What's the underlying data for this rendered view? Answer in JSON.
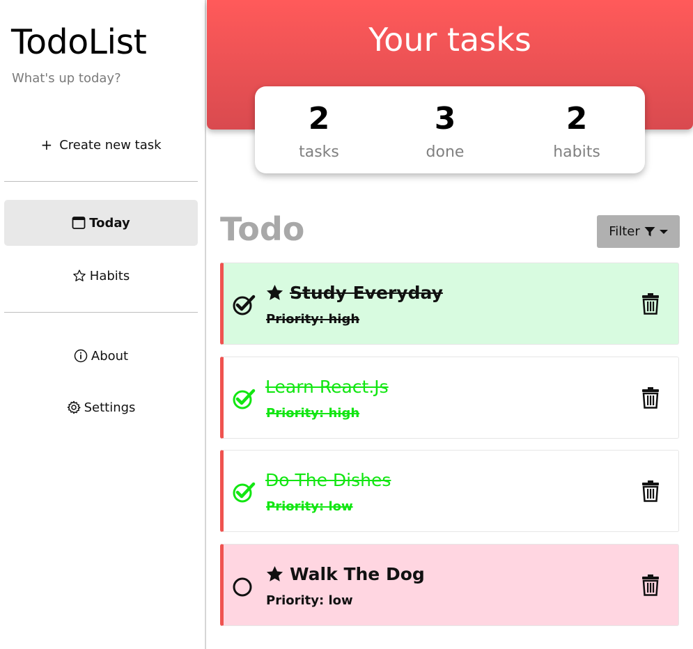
{
  "sidebar": {
    "title": "TodoList",
    "subtitle": "What's up today?",
    "create_label": "Create new task",
    "create_icon": "plus-icon",
    "items": [
      {
        "label": "Today",
        "icon": "calendar-icon",
        "active": true
      },
      {
        "label": "Habits",
        "icon": "star-outline-icon",
        "active": false
      },
      {
        "label": "About",
        "icon": "info-icon",
        "active": false
      },
      {
        "label": "Settings",
        "icon": "gear-icon",
        "active": false
      }
    ]
  },
  "header": {
    "title": "Your tasks",
    "colors": {
      "top": "#ff5a5a",
      "bottom": "#d94a4f"
    }
  },
  "stats": [
    {
      "value": "2",
      "label": "tasks"
    },
    {
      "value": "3",
      "label": "done"
    },
    {
      "value": "2",
      "label": "habits"
    }
  ],
  "section": {
    "title": "Todo",
    "filter_label": "Filter",
    "filter_icon": "funnel-icon"
  },
  "tasks": [
    {
      "title": "Study Everyday",
      "priority": "Priority: high",
      "done": true,
      "starred": true,
      "bg": "#d8fbe0",
      "text_color": "#111111"
    },
    {
      "title": "Learn React.Js",
      "priority": "Priority: high",
      "done": true,
      "starred": false,
      "bg": "#ffffff",
      "text_color": "#12e612"
    },
    {
      "title": "Do The Dishes",
      "priority": "Priority: low",
      "done": true,
      "starred": false,
      "bg": "#ffffff",
      "text_color": "#12e612"
    },
    {
      "title": "Walk The Dog",
      "priority": "Priority: low",
      "done": false,
      "starred": true,
      "bg": "#ffd6e1",
      "text_color": "#111111"
    }
  ]
}
